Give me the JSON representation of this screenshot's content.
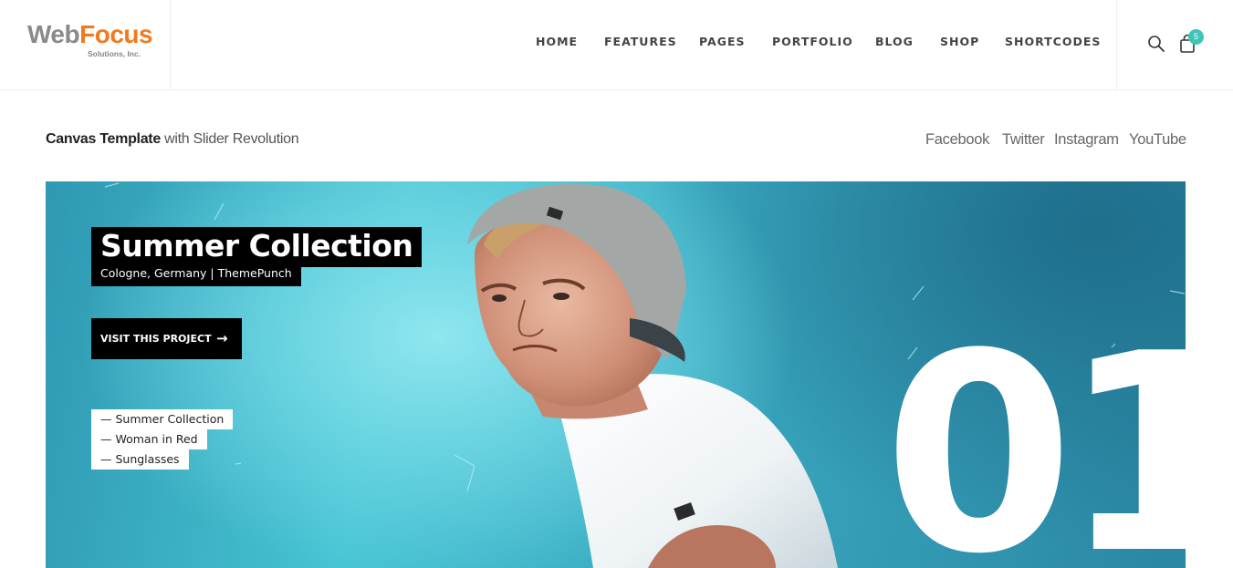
{
  "logo": {
    "main_a": "Web",
    "main_b": "Focus",
    "sub": "Solutions, Inc."
  },
  "nav": [
    "HOME",
    "FEATURES",
    "PAGES",
    "PORTFOLIO",
    "BLOG",
    "SHOP",
    "SHORTCODES"
  ],
  "cart": {
    "count": "5"
  },
  "subheader": {
    "bold": "Canvas Template",
    "rest": " with Slider Revolution"
  },
  "social": [
    "Facebook",
    "Twitter",
    "Instagram",
    "YouTube"
  ],
  "hero": {
    "title": "Summer Collection",
    "subtitle": "Cologne, Germany | ThemePunch",
    "cta_label": "VISIT THIS PROJECT",
    "cta_arrow": "→",
    "number": "01",
    "list": [
      "— Summer Collection",
      "— Woman in Red",
      "— Sunglasses"
    ]
  },
  "colors": {
    "accent": "#f27a1c",
    "badge": "#3ec5b6",
    "hero_bg": "#45c4d3"
  }
}
